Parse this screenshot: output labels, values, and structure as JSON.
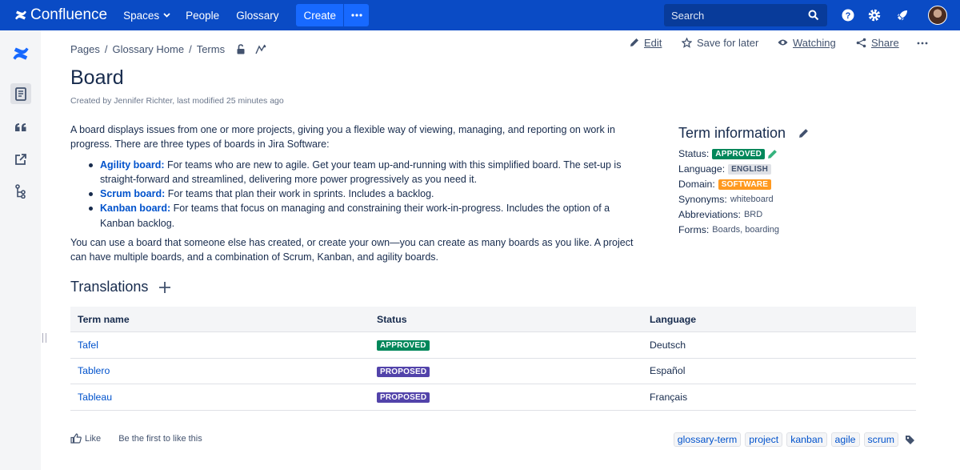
{
  "nav": {
    "app_name": "Confluence",
    "spaces": "Spaces",
    "people": "People",
    "glossary": "Glossary",
    "create": "Create",
    "search_placeholder": "Search"
  },
  "breadcrumb": [
    "Pages",
    "Glossary Home",
    "Terms"
  ],
  "actions": {
    "edit": "Edit",
    "save": "Save for later",
    "watching": "Watching",
    "share": "Share"
  },
  "page": {
    "title": "Board",
    "meta": "Created by Jennifer Richter, last modified 25 minutes ago",
    "intro": "A board displays issues from one or more projects, giving you a flexible way of viewing, managing, and reporting on work in progress. There are three types of boards in Jira Software:",
    "bullets": [
      {
        "name": "Agility board:",
        "text": " For teams who are new to agile. Get your team up-and-running with this simplified board. The set-up is straight-forward and streamlined, delivering more power progressively as you need it."
      },
      {
        "name": "Scrum board:",
        "text": " For teams that plan their work in sprints. Includes a backlog."
      },
      {
        "name": "Kanban board:",
        "text": " For teams that focus on managing and constraining their work-in-progress. Includes the option of a Kanban backlog."
      }
    ],
    "outro": "You can use a board that someone else has created, or create your own—you can create as many boards as you like. A project can have multiple boards, and a combination of Scrum, Kanban, and agility boards."
  },
  "term_info": {
    "heading": "Term information",
    "status_label": "Status:",
    "status": "APPROVED",
    "language_label": "Language:",
    "language": "ENGLISH",
    "domain_label": "Domain:",
    "domain": "SOFTWARE",
    "synonyms_label": "Synonyms:",
    "synonyms": "whiteboard",
    "abbrev_label": "Abbreviations:",
    "abbrev": "BRD",
    "forms_label": "Forms:",
    "forms": "Boards, boarding"
  },
  "translations": {
    "heading": "Translations",
    "columns": [
      "Term name",
      "Status",
      "Language"
    ],
    "rows": [
      {
        "term": "Tafel",
        "status": "APPROVED",
        "language": "Deutsch"
      },
      {
        "term": "Tablero",
        "status": "PROPOSED",
        "language": "Español"
      },
      {
        "term": "Tableau",
        "status": "PROPOSED",
        "language": "Français"
      }
    ]
  },
  "footer": {
    "like": "Like",
    "first": "Be the first to like this",
    "labels": [
      "glossary-term",
      "project",
      "kanban",
      "agile",
      "scrum"
    ]
  },
  "colors": {
    "nav": "#0a4bc5",
    "create": "#1769ff",
    "link": "#0052cc",
    "approved": "#00875a",
    "proposed": "#5243aa",
    "software": "#ff991f"
  }
}
